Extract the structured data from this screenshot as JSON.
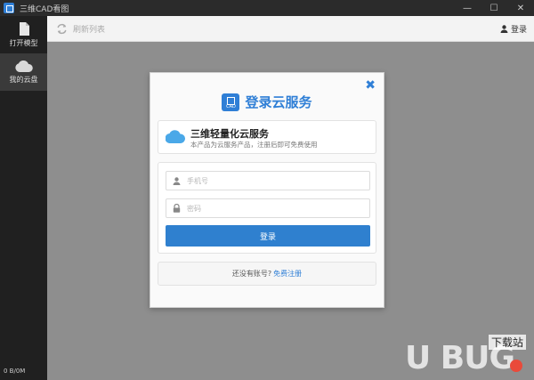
{
  "window": {
    "title": "三维CAD看图",
    "controls": {
      "minimize": "—",
      "maximize": "☐",
      "close": "✕"
    }
  },
  "sidebar": {
    "items": [
      {
        "label": "打开模型",
        "icon": "file-icon",
        "active": false
      },
      {
        "label": "我的云盘",
        "icon": "cloud-icon",
        "active": true
      }
    ],
    "storage": "0 B/0M"
  },
  "toolbar": {
    "refresh_label": "刷新列表",
    "login_label": "登录"
  },
  "dialog": {
    "title": "登录云服务",
    "logo_text": "CAD",
    "info_title": "三维轻量化云服务",
    "info_subtitle": "本产品为云服务产品，注册后即可免费使用",
    "phone_placeholder": "手机号",
    "password_placeholder": "密码",
    "login_button": "登录",
    "register_prompt": "还没有账号?",
    "register_link": "免费注册",
    "close_label": "✖"
  },
  "watermark": {
    "text": "U BUG",
    "tag": "下载站"
  },
  "colors": {
    "accent": "#2f7fd6",
    "sidebar_bg": "#202020",
    "main_bg": "#8e8e8e"
  }
}
